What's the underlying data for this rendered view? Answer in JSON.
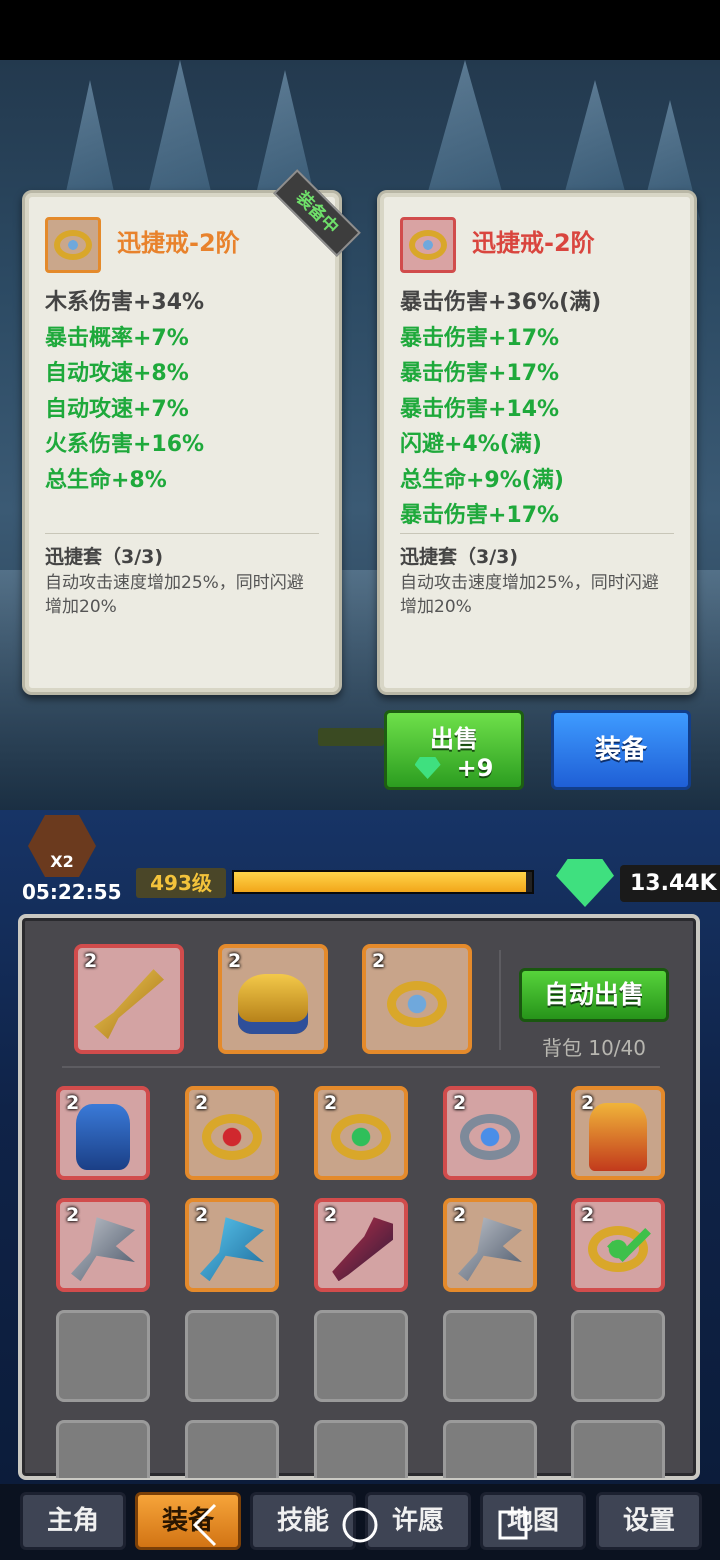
{
  "compare": {
    "equipped_tag": "装备中",
    "left": {
      "title": "迅捷戒-2阶",
      "icon": "ring-icon",
      "stats": [
        "木系伤害+34%",
        "暴击概率+7%",
        "自动攻速+8%",
        "自动攻速+7%",
        "火系伤害+16%",
        "总生命+8%"
      ],
      "set_name": "迅捷套（3/3)",
      "set_desc": "自动攻击速度增加25%，同时闪避增加20%"
    },
    "right": {
      "title": "迅捷戒-2阶",
      "icon": "ring-icon",
      "stats": [
        "暴击伤害+36%(满)",
        "暴击伤害+17%",
        "暴击伤害+17%",
        "暴击伤害+14%",
        "闪避+4%(满)",
        "总生命+9%(满)",
        "暴击伤害+17%"
      ],
      "set_name": "迅捷套（3/3)",
      "set_desc": "自动攻击速度增加25%，同时闪避增加20%"
    }
  },
  "actions": {
    "sell_label": "出售",
    "sell_price": "+9",
    "equip_label": "装备"
  },
  "status": {
    "buff_multiplier": "X2",
    "timer": "05:22:55",
    "level": "493级",
    "xp_fraction": 0.98,
    "gems": "13.44K"
  },
  "inventory": {
    "auto_sell_label": "自动出售",
    "bag_count": "背包 10/40",
    "equipped": [
      {
        "tier": "2",
        "icon": "sword-icon",
        "rarity": "red"
      },
      {
        "tier": "2",
        "icon": "helmet-icon",
        "rarity": "orange"
      },
      {
        "tier": "2",
        "icon": "ring-icon",
        "rarity": "orange"
      }
    ],
    "items": [
      {
        "tier": "2",
        "icon": "armor-icon",
        "rarity": "red"
      },
      {
        "tier": "2",
        "icon": "ruby-ring-icon",
        "rarity": "orange"
      },
      {
        "tier": "2",
        "icon": "emerald-ring-icon",
        "rarity": "orange"
      },
      {
        "tier": "2",
        "icon": "sapphire-ring-icon",
        "rarity": "red"
      },
      {
        "tier": "2",
        "icon": "cape-armor-icon",
        "rarity": "orange"
      },
      {
        "tier": "2",
        "icon": "axe-icon",
        "rarity": "red"
      },
      {
        "tier": "2",
        "icon": "ice-axe-icon",
        "rarity": "orange"
      },
      {
        "tier": "2",
        "icon": "dark-staff-icon",
        "rarity": "red"
      },
      {
        "tier": "2",
        "icon": "axe-icon",
        "rarity": "orange"
      },
      {
        "tier": "2",
        "icon": "ring-check-icon",
        "rarity": "red"
      }
    ]
  },
  "nav": {
    "tabs": [
      "主角",
      "装备",
      "技能",
      "许愿",
      "地图",
      "设置"
    ],
    "active": 1
  },
  "colors": {
    "green_stat": "#1ea93b",
    "orange_title": "#e8822c",
    "red_title": "#d9453e"
  }
}
